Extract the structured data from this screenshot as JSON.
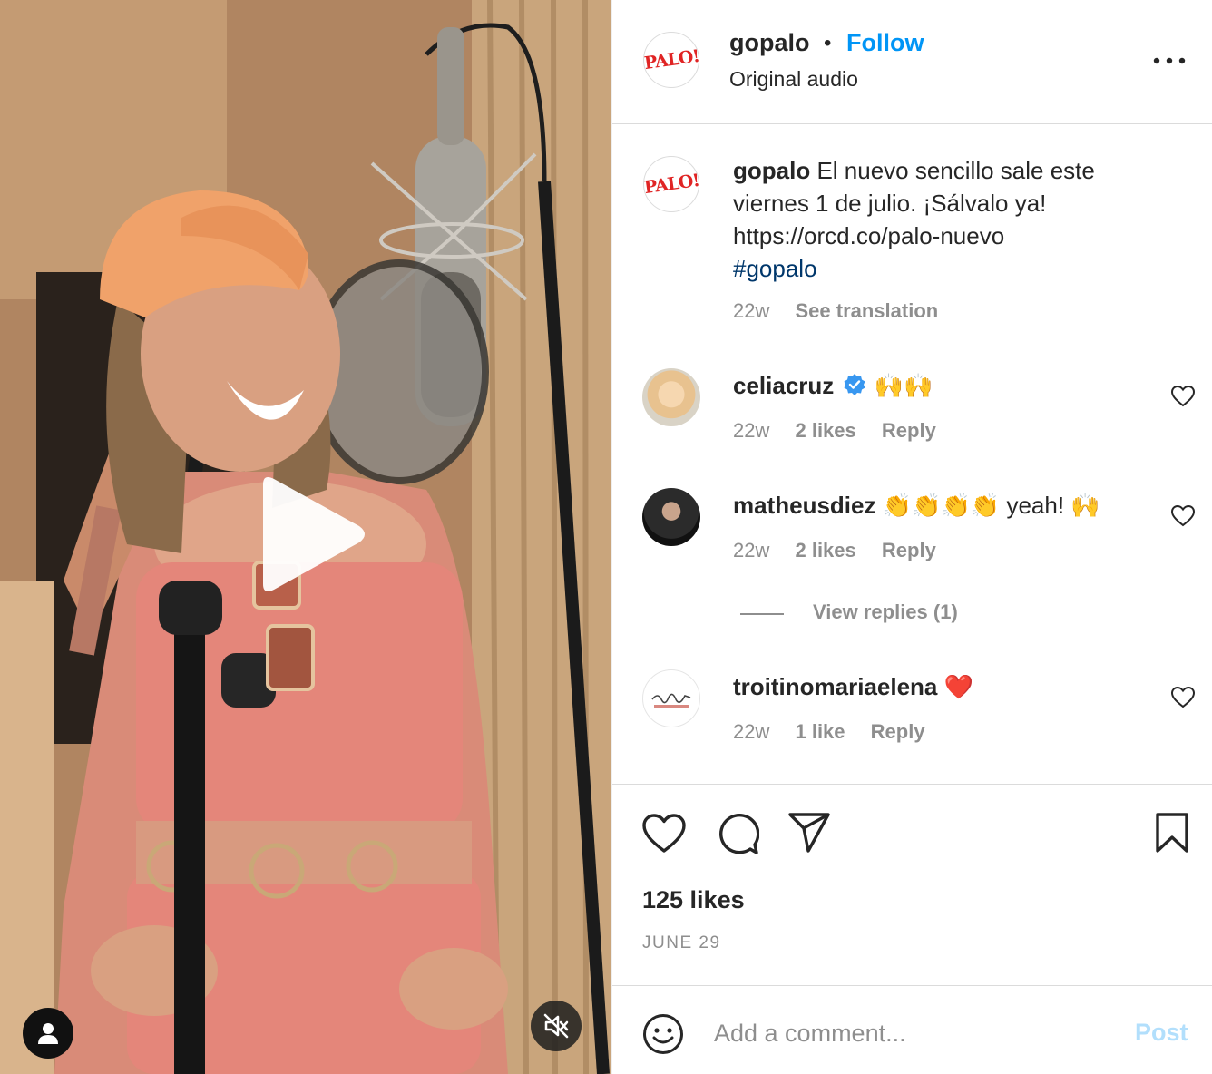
{
  "post": {
    "username": "gopalo",
    "separator": "•",
    "follow_label": "Follow",
    "audio_label": "Original audio",
    "avatar_text": "PALO!"
  },
  "caption": {
    "username": "gopalo",
    "text": " El nuevo sencillo sale este viernes 1 de julio. ¡Sálvalo ya! https://orcd.co/palo-nuevo",
    "hashtag": "#gopalo",
    "time": "22w",
    "translate_label": "See translation"
  },
  "comments": [
    {
      "username": "celiacruz",
      "verified": true,
      "text": "🙌🙌",
      "time": "22w",
      "likes": "2 likes",
      "reply": "Reply"
    },
    {
      "username": "matheusdiez",
      "verified": false,
      "text": "👏👏👏👏 yeah! 🙌",
      "time": "22w",
      "likes": "2 likes",
      "reply": "Reply"
    },
    {
      "username": "troitinomariaelena",
      "verified": false,
      "text": "❤️",
      "time": "22w",
      "likes": "1 like",
      "reply": "Reply"
    }
  ],
  "view_replies": "View replies (1)",
  "stats": {
    "likes": "125 likes",
    "date": "JUNE 29"
  },
  "comment_box": {
    "placeholder": "Add a comment...",
    "post_label": "Post"
  },
  "colors": {
    "link_blue": "#0095f6",
    "hashtag_blue": "#00376b",
    "muted_gray": "#8e8e8e",
    "post_disabled": "#b2dffc",
    "verified_blue": "#3897f0",
    "heart_red": "#ed4956"
  },
  "icons": [
    "play-icon",
    "user-icon",
    "muted-speaker-icon",
    "more-options-icon",
    "heart-icon",
    "comment-icon",
    "share-icon",
    "bookmark-icon",
    "emoji-icon",
    "verified-badge-icon"
  ]
}
